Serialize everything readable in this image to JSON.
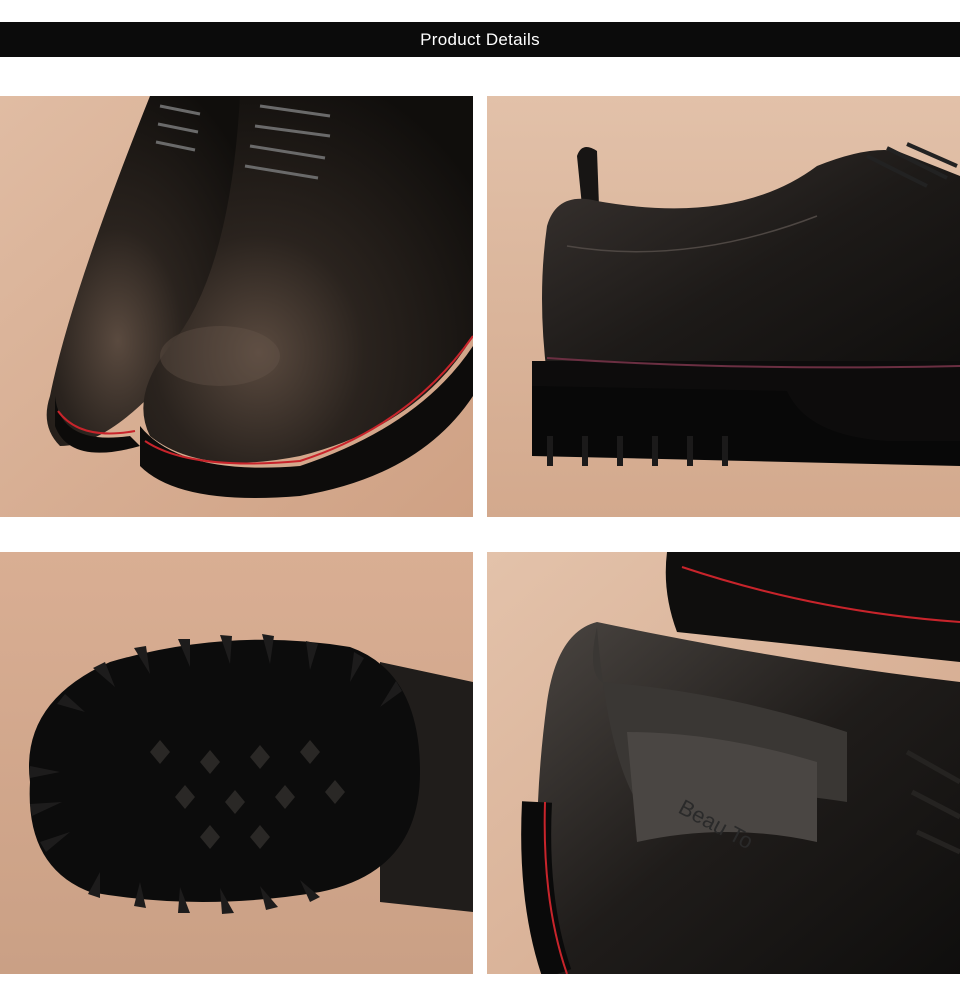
{
  "header": {
    "title": "Product Details"
  },
  "photos": [
    {
      "subject": "toe view of two shoes",
      "icon": "shoe-toe-photo"
    },
    {
      "subject": "side heel view",
      "icon": "shoe-heel-photo"
    },
    {
      "subject": "rubber lug outsole",
      "icon": "shoe-sole-photo"
    },
    {
      "subject": "interior insole",
      "icon": "shoe-insole-photo",
      "insole_brand": "Beau To"
    }
  ],
  "colors": {
    "background": "#d9b197",
    "leather": "#1c1a18",
    "stitch": "#c8242b",
    "header": "#0b0b0b"
  }
}
